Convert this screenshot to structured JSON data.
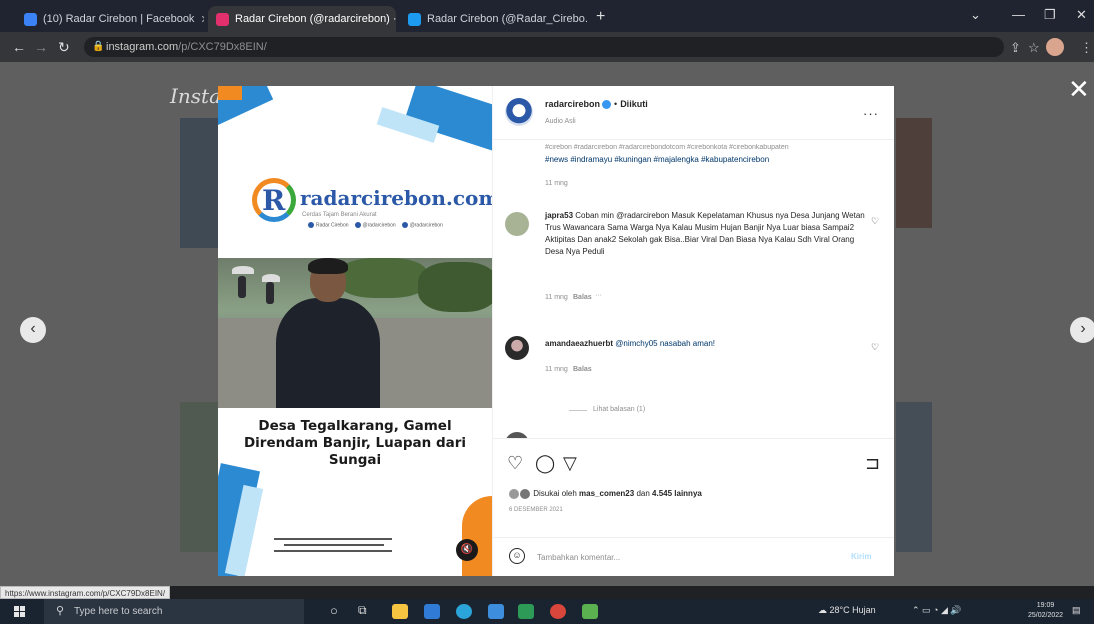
{
  "browser": {
    "tabs": [
      {
        "label": "(10) Radar Cirebon | Facebook",
        "active": false,
        "favicon_color": "#3b82f6"
      },
      {
        "label": "Radar Cirebon (@radarcirebon) ·",
        "active": true,
        "favicon_color": "#e1306c"
      },
      {
        "label": "Radar Cirebon (@Radar_Cirebo...",
        "active": false,
        "favicon_color": "#1d9bf0"
      }
    ],
    "new_tab": "+",
    "url_domain": "instagram.com",
    "url_path": "/p/CXC79Dx8EIN/"
  },
  "background_page": {
    "logo": "Insta"
  },
  "post": {
    "image": {
      "logo_text": "radarcirebon.com",
      "logo_sub": "Cerdas Tajam Berani Akurat",
      "socials": [
        "Radar Cirebon",
        "@radarcirebon",
        "@radarcirebon"
      ],
      "headline_line1": "Desa Tegalkarang, Gamel",
      "headline_line2": "Direndam Banjir, Luapan dari Sungai"
    },
    "header": {
      "username": "radarcirebon",
      "follow_label": "Diikuti",
      "audio_label": "Audio Asli",
      "more": "···"
    },
    "caption": {
      "partial_line": "#cirebon #radarcirebon #radarcirebondotcom #cirebonkota #cirebonkabupaten",
      "hashtags": "#news #indramayu #kuningan #majalengka #kabupatencirebon",
      "time": "11 mng"
    },
    "comments": [
      {
        "username": "japra53",
        "text": "Coban min @radarcirebon Masuk Kepelataman Khusus nya Desa Junjang Wetan Trus Wawancara Sama Warga Nya Kalau Musim Hujan Banjir Nya Luar biasa Sampai2 Aktipitas Dan anak2 Sekolah gak Bisa..Biar Viral Dan Biasa Nya Kalau Sdh Viral Orang Desa Nya Peduli",
        "time": "11 mng",
        "reply": "Balas",
        "more": "···"
      },
      {
        "username": "amandaeazhuerbt",
        "text": "@nimchy05 nasabah aman!",
        "time": "11 mng",
        "reply": "Balas"
      }
    ],
    "view_replies": "Lihat balasan (1)",
    "likes_prefix": "Disukai oleh",
    "likes_user": "mas_comen23",
    "likes_mid": "dan",
    "likes_count": "4.545 lainnya",
    "date": "6 DESEMBER 2021",
    "add_comment_placeholder": "Tambahkan komentar...",
    "post_button": "Kirim"
  },
  "status_url": "https://www.instagram.com/p/CXC79Dx8EIN/",
  "taskbar": {
    "search_placeholder": "Type here to search",
    "weather": "28°C  Hujan",
    "time": "19:09",
    "date": "25/02/2022"
  },
  "colors": {
    "accent_blue": "#2b8ad1",
    "accent_orange": "#f28a22",
    "link": "#00376b"
  }
}
